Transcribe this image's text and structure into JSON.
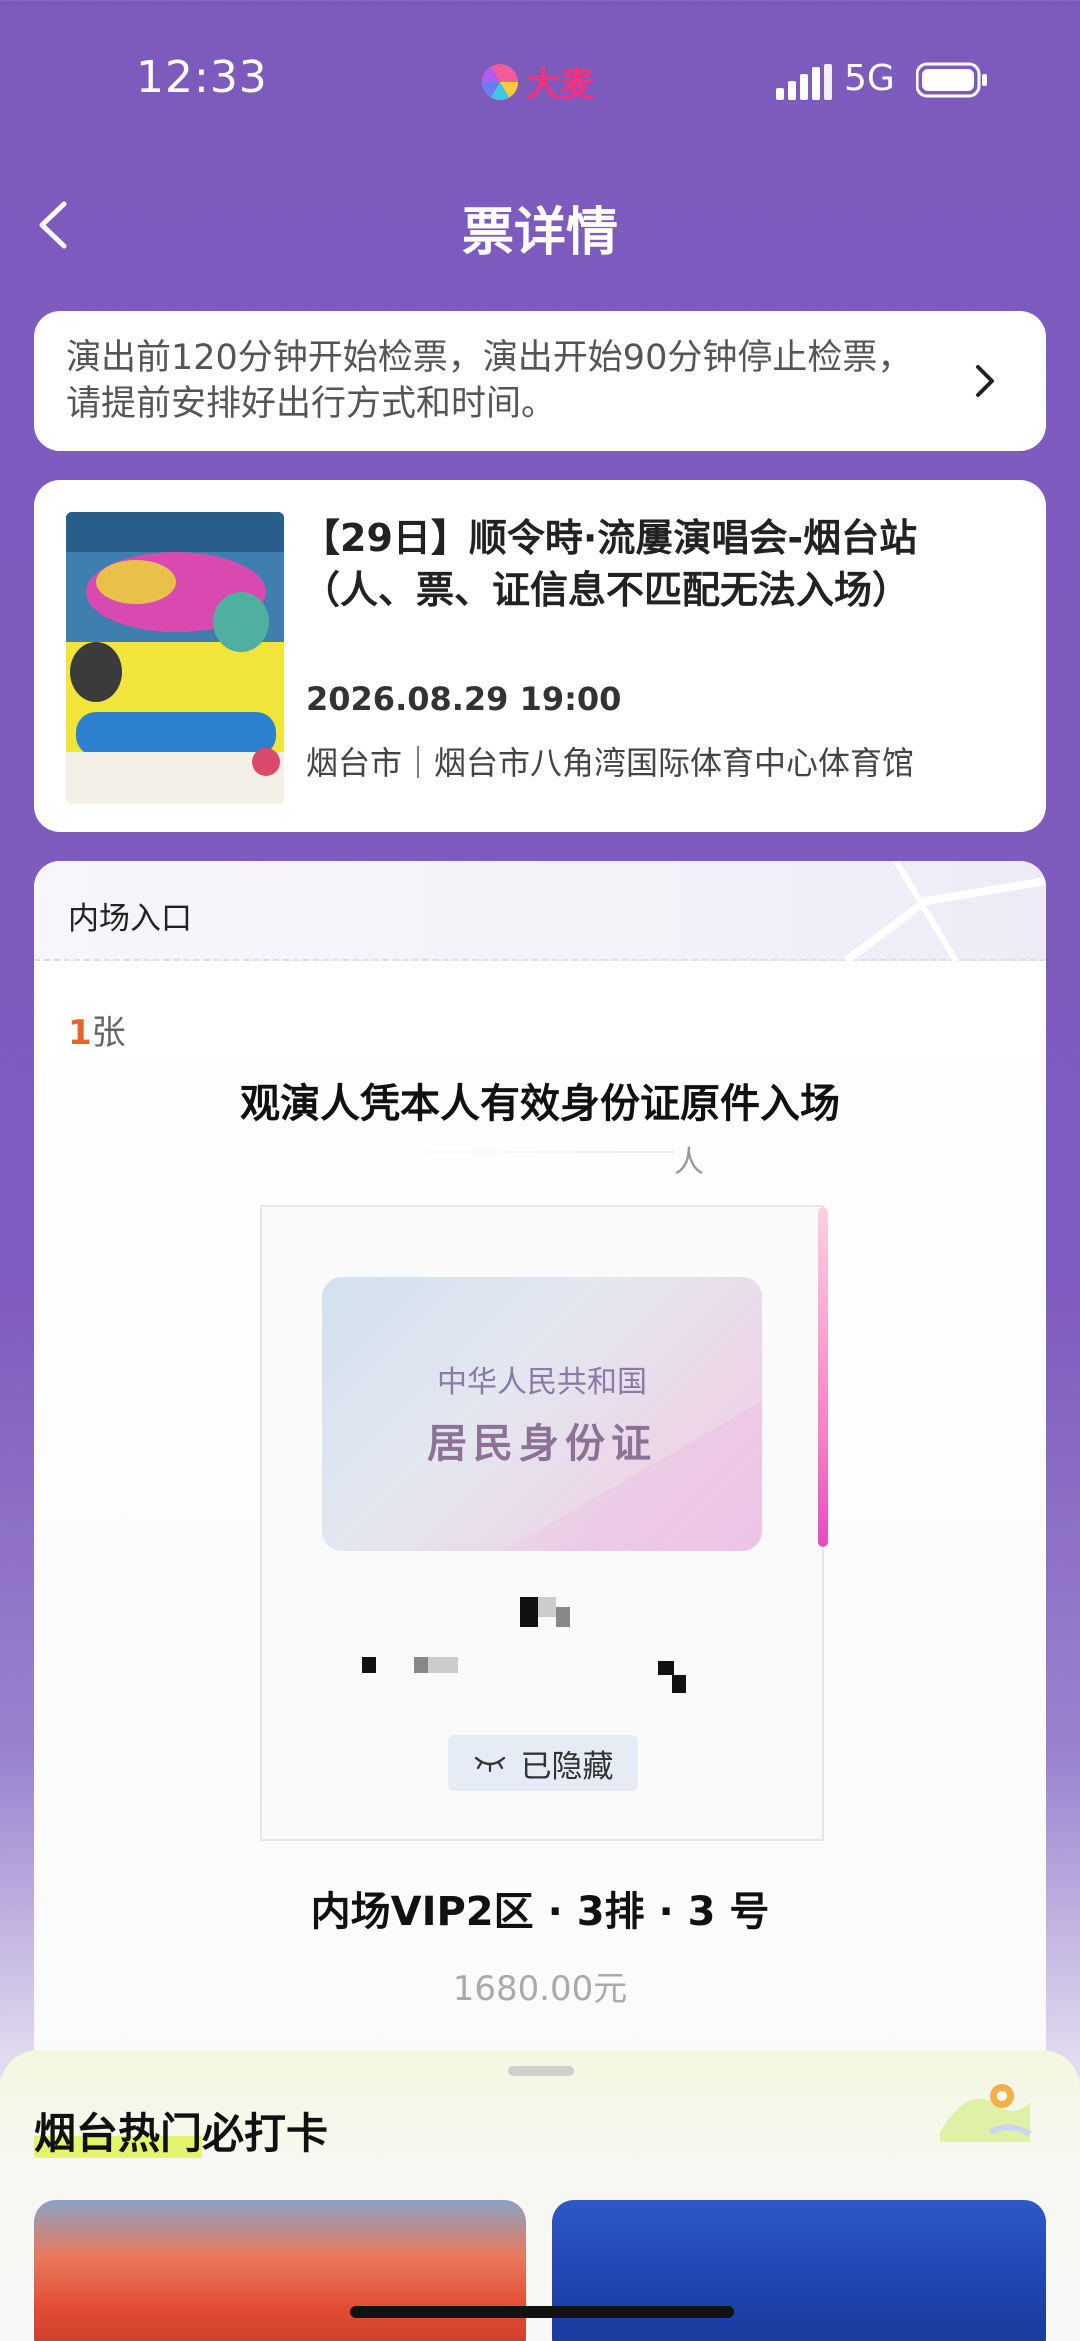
{
  "status": {
    "time": "12:33",
    "network": "5G",
    "logo_name": "damai-logo"
  },
  "nav": {
    "title": "票详情"
  },
  "notice": {
    "text": "演出前120分钟开始检票，演出开始90分钟停止检票，请提前安排好出行方式和时间。"
  },
  "event": {
    "title": "【29日】顺令時·流屢演唱会-烟台站（人、票、证信息不匹配无法入场）",
    "datetime": "2026.08.29 19:00",
    "venue": "烟台市｜烟台市八角湾国际体育中心体育馆"
  },
  "ticket": {
    "entrance": "内场入口",
    "count": "1",
    "count_unit": "张",
    "id_notice": "观演人凭本人有效身份证原件入场",
    "holder_suffix": "人",
    "id_card": {
      "country": "中华人民共和国",
      "type": "居民身份证"
    },
    "hidden_label": "已隐藏",
    "seat": "内场VIP2区 · 3排 · 3  号",
    "price": "1680.00元"
  },
  "sheet": {
    "title_highlight": "烟台热门",
    "title_rest": "必打卡"
  },
  "colors": {
    "brand_purple": "#7d5bbd",
    "count_orange": "#e8622c",
    "highlight_yellow": "#e4f56b"
  }
}
